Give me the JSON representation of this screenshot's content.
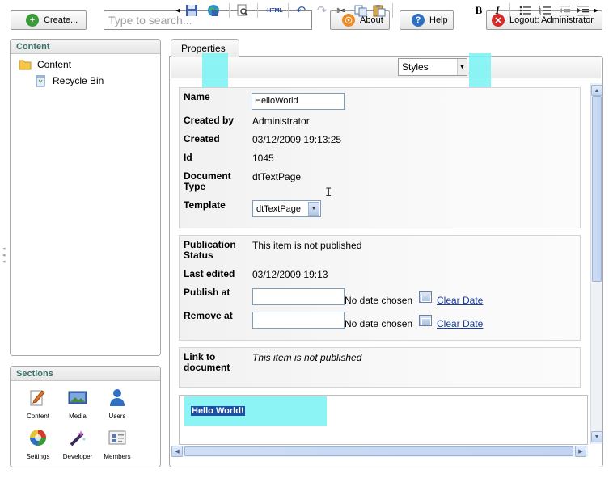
{
  "header": {
    "create_label": "Create...",
    "search_placeholder": "Type to search...",
    "about_label": "About",
    "help_label": "Help",
    "logout_label": "Logout: Administrator"
  },
  "content_panel": {
    "title": "Content",
    "items": [
      {
        "label": "Content",
        "icon": "folder-icon"
      },
      {
        "label": "Recycle Bin",
        "icon": "recycle-bin-icon"
      }
    ]
  },
  "sections_panel": {
    "title": "Sections",
    "items": [
      {
        "label": "Content"
      },
      {
        "label": "Media"
      },
      {
        "label": "Users"
      },
      {
        "label": "Settings"
      },
      {
        "label": "Developer"
      },
      {
        "label": "Members"
      }
    ]
  },
  "tab": {
    "label": "Properties"
  },
  "toolbar": {
    "html_label": "HTML",
    "styles_label": "Styles",
    "bold_label": "B",
    "italic_label": "I"
  },
  "properties": {
    "name_label": "Name",
    "name_value": "HelloWorld",
    "created_by_label": "Created by",
    "created_by_value": "Administrator",
    "created_label": "Created",
    "created_value": "03/12/2009 19:13:25",
    "id_label": "Id",
    "id_value": "1045",
    "doctype_label_1": "Document",
    "doctype_label_2": "Type",
    "doctype_value": "dtTextPage",
    "template_label": "Template",
    "template_value": "dtTextPage"
  },
  "publication": {
    "status_label_1": "Publication",
    "status_label_2": "Status",
    "status_value": "This item is not published",
    "last_edited_label": "Last edited",
    "last_edited_value": "03/12/2009 19:13",
    "publish_at_label": "Publish at",
    "publish_at_status": "No date chosen",
    "publish_clear": "Clear Date",
    "remove_at_label": "Remove at",
    "remove_at_status": "No date chosen",
    "remove_clear": "Clear Date"
  },
  "link": {
    "label_1": "Link to",
    "label_2": "document",
    "value": "This item is not published"
  },
  "editor": {
    "content": "Hello World!"
  },
  "colors": {
    "highlight": "#7ff3f3",
    "section_title": "#39716b",
    "link": "#1a3fa0"
  }
}
